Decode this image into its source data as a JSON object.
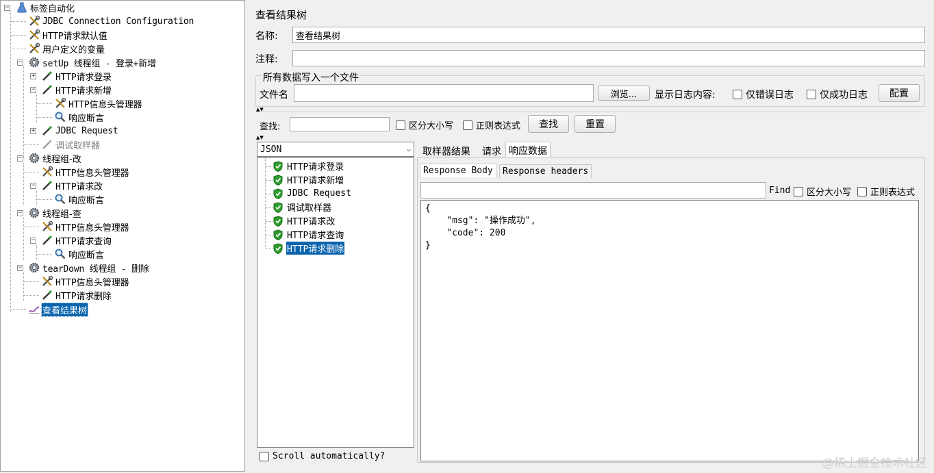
{
  "tree": {
    "nodes": [
      {
        "id": "root",
        "label": "标签自动化",
        "icon": "flask-icon"
      },
      {
        "id": "jdbc-config",
        "label": "JDBC Connection Configuration",
        "icon": "wrench-icon"
      },
      {
        "id": "http-defaults",
        "label": "HTTP请求默认值",
        "icon": "wrench-icon"
      },
      {
        "id": "user-vars",
        "label": "用户定义的变量",
        "icon": "wrench-icon"
      },
      {
        "id": "setup-group",
        "label": "setUp 线程组 - 登录+新增",
        "icon": "gear-icon"
      },
      {
        "id": "http-login",
        "label": "HTTP请求登录",
        "icon": "pipette-icon"
      },
      {
        "id": "http-add",
        "label": "HTTP请求新增",
        "icon": "pipette-icon"
      },
      {
        "id": "header-mgr-1",
        "label": "HTTP信息头管理器",
        "icon": "wrench-icon"
      },
      {
        "id": "assert-1",
        "label": "响应断言",
        "icon": "magnifier-icon"
      },
      {
        "id": "jdbc-request",
        "label": "JDBC Request",
        "icon": "pipette-icon"
      },
      {
        "id": "debug-sampler",
        "label": "调试取样器",
        "icon": "pipette-icon"
      },
      {
        "id": "group-update",
        "label": "线程组-改",
        "icon": "gear-icon"
      },
      {
        "id": "header-mgr-2",
        "label": "HTTP信息头管理器",
        "icon": "wrench-icon"
      },
      {
        "id": "http-update",
        "label": "HTTP请求改",
        "icon": "pipette-icon"
      },
      {
        "id": "assert-2",
        "label": "响应断言",
        "icon": "magnifier-icon"
      },
      {
        "id": "group-query",
        "label": "线程组-查",
        "icon": "gear-icon"
      },
      {
        "id": "header-mgr-3",
        "label": "HTTP信息头管理器",
        "icon": "wrench-icon"
      },
      {
        "id": "http-query",
        "label": "HTTP请求查询",
        "icon": "pipette-icon"
      },
      {
        "id": "assert-3",
        "label": "响应断言",
        "icon": "magnifier-icon"
      },
      {
        "id": "teardown-group",
        "label": "tearDown 线程组 - 删除",
        "icon": "gear-icon"
      },
      {
        "id": "header-mgr-4",
        "label": "HTTP信息头管理器",
        "icon": "wrench-icon"
      },
      {
        "id": "http-delete",
        "label": "HTTP请求删除",
        "icon": "pipette-icon"
      },
      {
        "id": "view-results-tree",
        "label": "查看结果树",
        "icon": "graph-icon"
      }
    ]
  },
  "panel": {
    "title": "查看结果树",
    "name_label": "名称:",
    "name_value": "查看结果树",
    "comment_label": "注释:",
    "comment_value": "",
    "file_group_title": "所有数据写入一个文件",
    "filename_label": "文件名",
    "filename_value": "",
    "browse_label": "浏览...",
    "log_content_label": "显示日志内容:",
    "errors_only_label": "仅错误日志",
    "success_only_label": "仅成功日志",
    "configure_label": "配置",
    "search_label": "查找:",
    "search_value": "",
    "case_sensitive_label": "区分大小写",
    "regex_label": "正则表达式",
    "find_button_label": "查找",
    "reset_button_label": "重置"
  },
  "results": {
    "renderer_selected": "JSON",
    "samples": [
      "HTTP请求登录",
      "HTTP请求新增",
      "JDBC Request",
      "调试取样器",
      "HTTP请求改",
      "HTTP请求查询",
      "HTTP请求删除"
    ],
    "scroll_auto_label": "Scroll automatically?",
    "tabs": [
      "取样器结果",
      "请求",
      "响应数据"
    ],
    "subtabs": [
      "Response Body",
      "Response headers"
    ],
    "find_label": "Find",
    "find_value": "",
    "case_sensitive_label": "区分大小写",
    "regex_label": "正则表达式",
    "response_body": "{\n    \"msg\": \"操作成功\",\n    \"code\": 200\n}"
  },
  "watermark": "@稀土掘金技术社区",
  "colors": {
    "selection": "#0a64ad",
    "success_shield": "#2e9d2e"
  }
}
